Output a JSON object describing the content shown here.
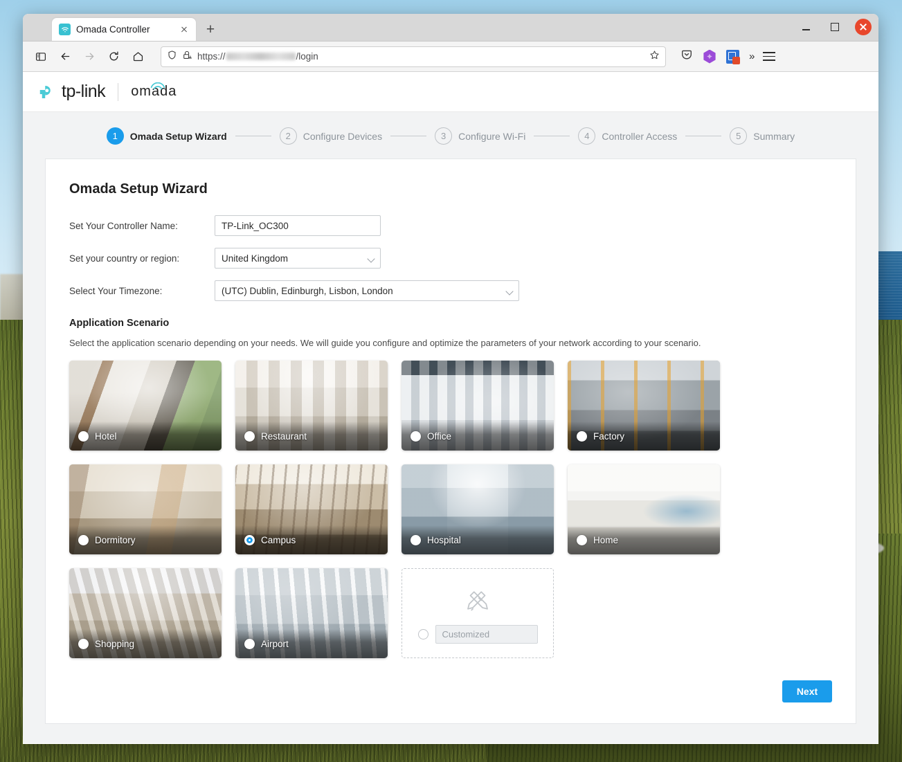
{
  "browser": {
    "tab": {
      "title": "Omada Controller",
      "favicon_icon": "wifi-icon",
      "close_icon": "close-icon"
    },
    "new_tab_icon": "plus-icon",
    "window_controls": {
      "minimize_icon": "minimize-icon",
      "maximize_icon": "maximize-icon",
      "close_icon": "close-icon"
    },
    "nav": {
      "sidebar_icon": "sidebar-panel-icon",
      "back_icon": "back-arrow-icon",
      "forward_icon": "forward-arrow-icon",
      "reload_icon": "reload-icon",
      "home_icon": "home-icon"
    },
    "url": {
      "shield_icon": "shield-icon",
      "lock_warning_icon": "lock-warning-icon",
      "prefix": "https://",
      "host_redacted": "",
      "path": "/login",
      "bookmark_icon": "star-icon"
    },
    "toolbar_right": {
      "pocket_icon": "pocket-icon",
      "extension1_icon": "puzzle-extension-icon",
      "extension2_icon": "bitwarden-extension-icon",
      "overflow_icon": "chevron-double-right-icon",
      "menu_icon": "hamburger-menu-icon"
    }
  },
  "brand": {
    "tplink_mark_icon": "tp-link-logo-icon",
    "tplink_name": "tp-link",
    "omada_name": "omada",
    "omada_wifi_icon": "wifi-arc-icon",
    "accent_color": "#4ACBD6"
  },
  "steps": [
    {
      "number": "1",
      "label": "Omada Setup Wizard",
      "active": true
    },
    {
      "number": "2",
      "label": "Configure Devices",
      "active": false
    },
    {
      "number": "3",
      "label": "Configure Wi-Fi",
      "active": false
    },
    {
      "number": "4",
      "label": "Controller Access",
      "active": false
    },
    {
      "number": "5",
      "label": "Summary",
      "active": false
    }
  ],
  "wizard": {
    "title": "Omada Setup Wizard",
    "fields": {
      "controller_name": {
        "label": "Set Your Controller Name:",
        "value": "TP-Link_OC300"
      },
      "country": {
        "label": "Set your country or region:",
        "value": "United Kingdom",
        "caret_icon": "chevron-down-icon"
      },
      "timezone": {
        "label": "Select Your Timezone:",
        "value": "(UTC) Dublin, Edinburgh, Lisbon, London",
        "caret_icon": "chevron-down-icon"
      }
    },
    "scenario": {
      "title": "Application Scenario",
      "description": "Select the application scenario depending on your needs. We will guide you configure and optimize the parameters of your network according to your scenario.",
      "selected": "Campus",
      "items": [
        {
          "label": "Hotel",
          "selected": false,
          "img": "img-hotel"
        },
        {
          "label": "Restaurant",
          "selected": false,
          "img": "img-restaurant"
        },
        {
          "label": "Office",
          "selected": false,
          "img": "img-office"
        },
        {
          "label": "Factory",
          "selected": false,
          "img": "img-factory"
        },
        {
          "label": "Dormitory",
          "selected": false,
          "img": "img-dormitory"
        },
        {
          "label": "Campus",
          "selected": true,
          "img": "img-campus"
        },
        {
          "label": "Hospital",
          "selected": false,
          "img": "img-hospital"
        },
        {
          "label": "Home",
          "selected": false,
          "img": "img-home"
        },
        {
          "label": "Shopping",
          "selected": false,
          "img": "img-shopping"
        },
        {
          "label": "Airport",
          "selected": false,
          "img": "img-airport"
        }
      ],
      "custom": {
        "icon": "pencil-ruler-icon",
        "placeholder": "Customized",
        "value": "",
        "selected": false
      }
    },
    "next_label": "Next",
    "button_color": "#1A9CEB"
  }
}
